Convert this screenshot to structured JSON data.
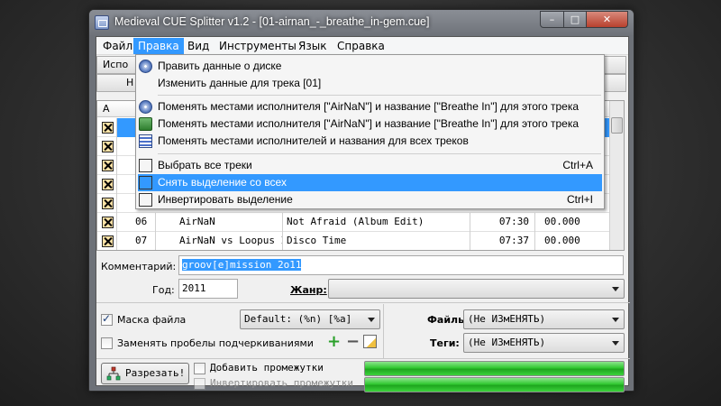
{
  "window": {
    "title": "Medieval CUE Splitter v1.2 - [01-airnan_-_breathe_in-gem.cue]",
    "min_glyph": "–",
    "max_glyph": "□",
    "close_glyph": "✕"
  },
  "menubar": {
    "items": [
      "Файл",
      "Правка",
      "Вид",
      "Инструменты",
      "Язык",
      "Справка"
    ],
    "active": "Правка"
  },
  "toolbar": {
    "btn1": "Испо",
    "btn2": "Н"
  },
  "grid": {
    "col_a": "A",
    "rows": [
      {
        "num": "06",
        "artist": "AirNaN",
        "title": "Not Afraid (Album Edit)",
        "length": "07:30",
        "start": "00.000"
      },
      {
        "num": "07",
        "artist": "AirNaN vs Loopus In",
        "title": "Disco Time",
        "length": "07:37",
        "start": "00.000"
      }
    ]
  },
  "dropdown": {
    "items": [
      {
        "label": "Править данные о диске",
        "icon": "disc-icon",
        "shortcut": ""
      },
      {
        "label": "Изменить данные для трека [01]",
        "icon": "",
        "shortcut": ""
      },
      {
        "label": "Поменять местами исполнителя [\"AirNaN\"] и название [\"Breathe In\"] для этого трека",
        "icon": "swap-disc-icon",
        "shortcut": ""
      },
      {
        "label": "Поменять местами исполнителя [\"AirNaN\"] и название [\"Breathe In\"] для этого трека",
        "icon": "swap-icon",
        "shortcut": ""
      },
      {
        "label": "Поменять местами исполнителей и названия для всех треков",
        "icon": "list-icon",
        "shortcut": ""
      },
      {
        "label": "Выбрать все треки",
        "icon": "select-all-icon",
        "shortcut": "Ctrl+A"
      },
      {
        "label": "Снять выделение со всех",
        "icon": "deselect-all-icon",
        "shortcut": ""
      },
      {
        "label": "Инвертировать выделение",
        "icon": "invert-selection-icon",
        "shortcut": "Ctrl+I"
      }
    ],
    "highlighted_index": 6
  },
  "form": {
    "comment_label": "Комментарий:",
    "comment_value": "groov[e]mission 2o11",
    "year_label": "Год:",
    "year_value": "2011",
    "genre_label": "Жанр:",
    "genre_value": ""
  },
  "options": {
    "file_mask_label": "Маска файла",
    "file_mask_checked": true,
    "file_mask_value": "Default: (%n) [%a]",
    "replace_spaces_label": "Заменять пробелы подчеркиваниями",
    "replace_spaces_checked": false,
    "files_label": "Файлы:",
    "files_value": "(Не ИЗмЕНЯТЬ)",
    "tags_label": "Теги:",
    "tags_value": "(Не ИЗмЕНЯТЬ)",
    "add_plus": "+",
    "add_minus": "−"
  },
  "actions": {
    "split_label": "Разрезать!",
    "add_gaps_label": "Добавить промежутки",
    "add_gaps_checked": false,
    "invert_gaps_label": "Инвертировать промежутки",
    "invert_gaps_checked": false,
    "progress_1": 1.0,
    "progress_2": 1.0
  },
  "colors": {
    "accent": "#3399ff",
    "progress": "#31c831",
    "titlebar": "#6f737a"
  }
}
